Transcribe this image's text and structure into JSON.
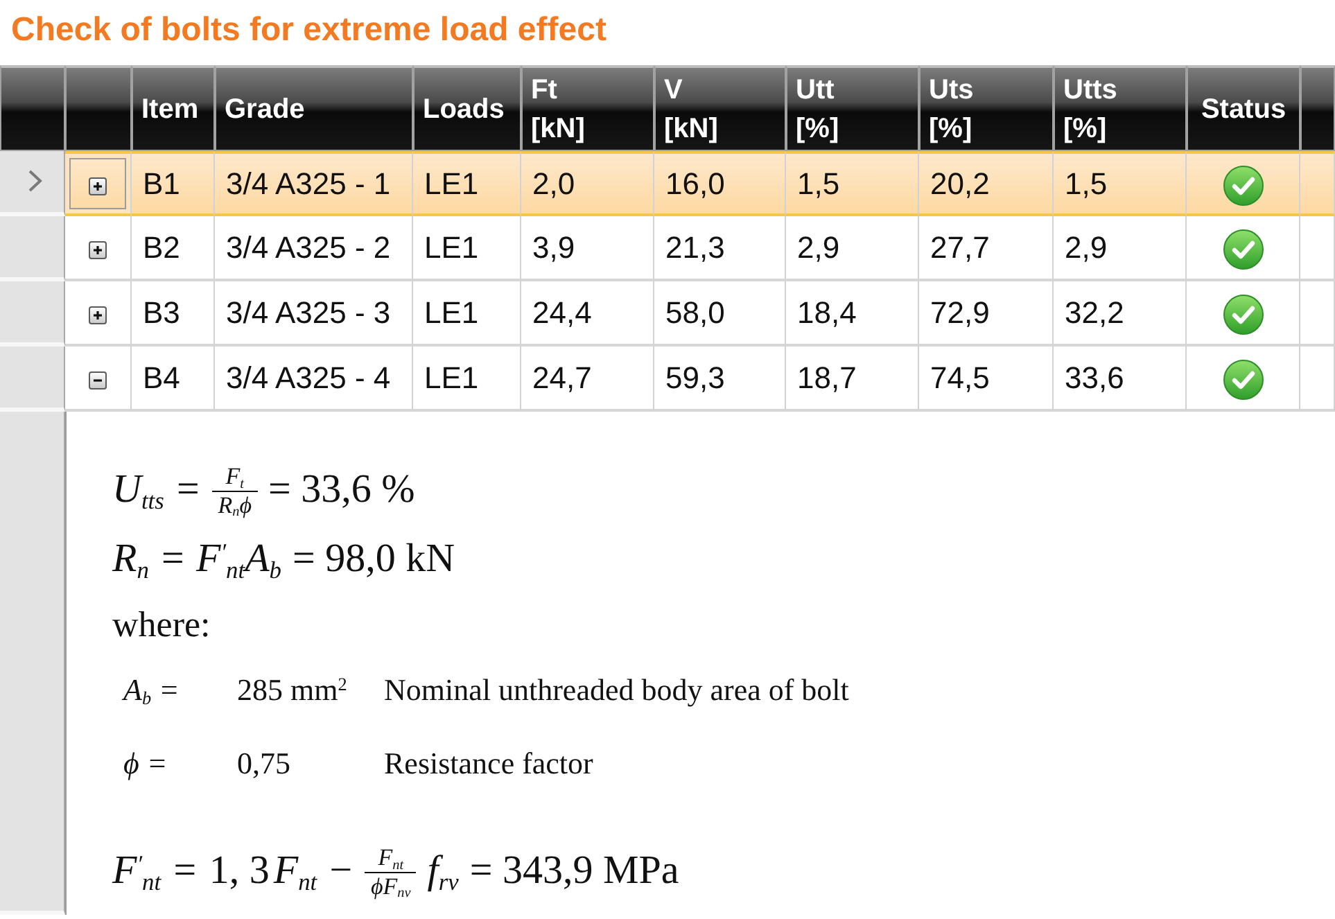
{
  "title": "Check of bolts for extreme load effect",
  "table": {
    "columns": [
      {
        "label": "Item"
      },
      {
        "label": "Grade"
      },
      {
        "label": "Loads"
      },
      {
        "label": "Ft",
        "unit": "[kN]"
      },
      {
        "label": "V",
        "unit": "[kN]"
      },
      {
        "label": "Utt",
        "unit": "[%]"
      },
      {
        "label": "Uts",
        "unit": "[%]"
      },
      {
        "label": "Utts",
        "unit": "[%]"
      },
      {
        "label": "Status"
      }
    ],
    "rows": [
      {
        "selected": true,
        "expanded": false,
        "cells": [
          "B1",
          "3/4 A325 - 1",
          "LE1",
          "2,0",
          "16,0",
          "1,5",
          "20,2",
          "1,5"
        ],
        "passed": true
      },
      {
        "selected": false,
        "expanded": false,
        "cells": [
          "B2",
          "3/4 A325 - 2",
          "LE1",
          "3,9",
          "21,3",
          "2,9",
          "27,7",
          "2,9"
        ],
        "passed": true
      },
      {
        "selected": false,
        "expanded": false,
        "cells": [
          "B3",
          "3/4 A325 - 3",
          "LE1",
          "24,4",
          "58,0",
          "18,4",
          "72,9",
          "32,2"
        ],
        "passed": true
      },
      {
        "selected": false,
        "expanded": true,
        "cells": [
          "B4",
          "3/4 A325 - 4",
          "LE1",
          "24,7",
          "59,3",
          "18,7",
          "74,5",
          "33,6"
        ],
        "passed": true,
        "detail": {
          "lines": [
            {
              "kind": "equation",
              "parts": [
                {
                  "kind": "math",
                  "text": "U$_{tts}$ ="
                },
                {
                  "kind": "fraction",
                  "numerator": "F$_{t}$",
                  "denominator": "R$_{n}$ϕ"
                },
                {
                  "kind": "text",
                  "text": "= 33,6 %"
                }
              ]
            },
            {
              "kind": "equation",
              "parts": [
                {
                  "kind": "math",
                  "text": "R$_{n}$ = F$^{′}$$_{nt}$A$_{b}$"
                },
                {
                  "kind": "text",
                  "text": "= 98,0 kN"
                }
              ]
            },
            {
              "kind": "text",
              "text": "where:"
            },
            {
              "kind": "definition",
              "symbol": "A$_{b}$ =",
              "value": "285 mm$^{2}$",
              "description": "Nominal unthreaded body area of bolt"
            },
            {
              "kind": "definition",
              "symbol": "ϕ =",
              "value": "0,75",
              "description": "Resistance factor"
            },
            {
              "kind": "equation",
              "parts": [
                {
                  "kind": "math",
                  "text": "F$^{′}$$_{nt}$ ="
                },
                {
                  "kind": "text",
                  "text": "1, 3"
                },
                {
                  "kind": "math",
                  "text": "F$_{nt}$ −"
                },
                {
                  "kind": "fraction",
                  "numerator": "F$_{nt}$",
                  "denominator": "ϕF$_{nv}$"
                },
                {
                  "kind": "math",
                  "text": "f$_{rv}$"
                },
                {
                  "kind": "text",
                  "text": "= 343,9 MPa"
                }
              ]
            }
          ]
        }
      }
    ]
  }
}
